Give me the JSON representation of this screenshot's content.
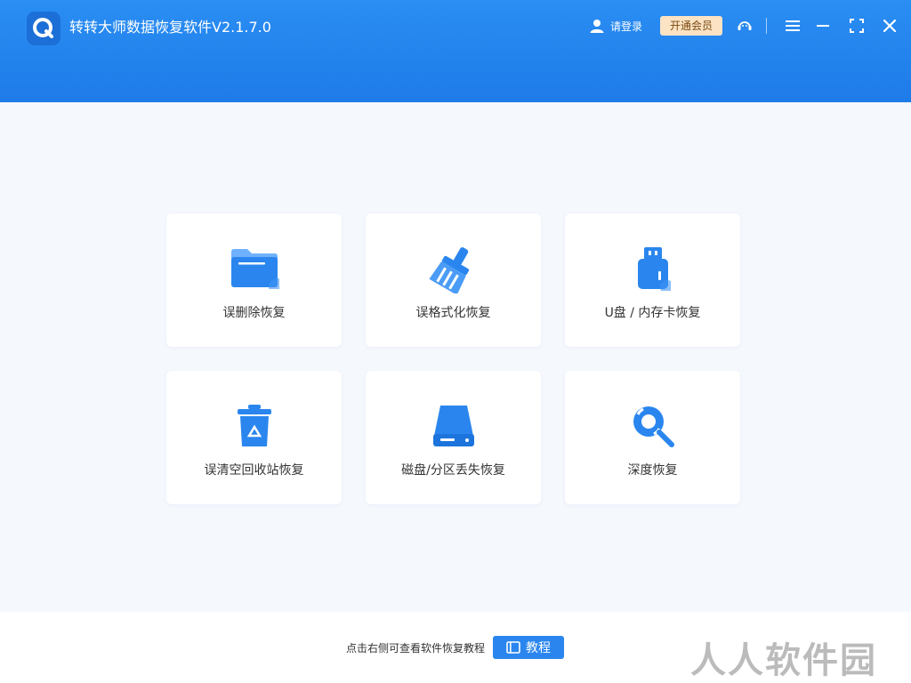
{
  "header": {
    "app_title": "转转大师数据恢复软件V2.1.7.0",
    "login_label": "请登录",
    "vip_label": "开通会员"
  },
  "cards": [
    {
      "label": "误删除恢复",
      "icon": "folder-icon"
    },
    {
      "label": "误格式化恢复",
      "icon": "broom-icon"
    },
    {
      "label": "U盘 / 内存卡恢复",
      "icon": "usb-drive-icon"
    },
    {
      "label": "误清空回收站恢复",
      "icon": "recycle-bin-icon"
    },
    {
      "label": "磁盘/分区丢失恢复",
      "icon": "hard-disk-icon"
    },
    {
      "label": "深度恢复",
      "icon": "deep-scan-icon"
    }
  ],
  "footer": {
    "tip": "点击右侧可查看软件恢复教程",
    "tutorial_label": "教程"
  },
  "watermark": "人人软件园",
  "colors": {
    "header_blue": "#1e7be8",
    "accent_blue": "#2a86ee",
    "vip_bg": "#fbe3c4",
    "page_bg": "#f5f8fd"
  }
}
